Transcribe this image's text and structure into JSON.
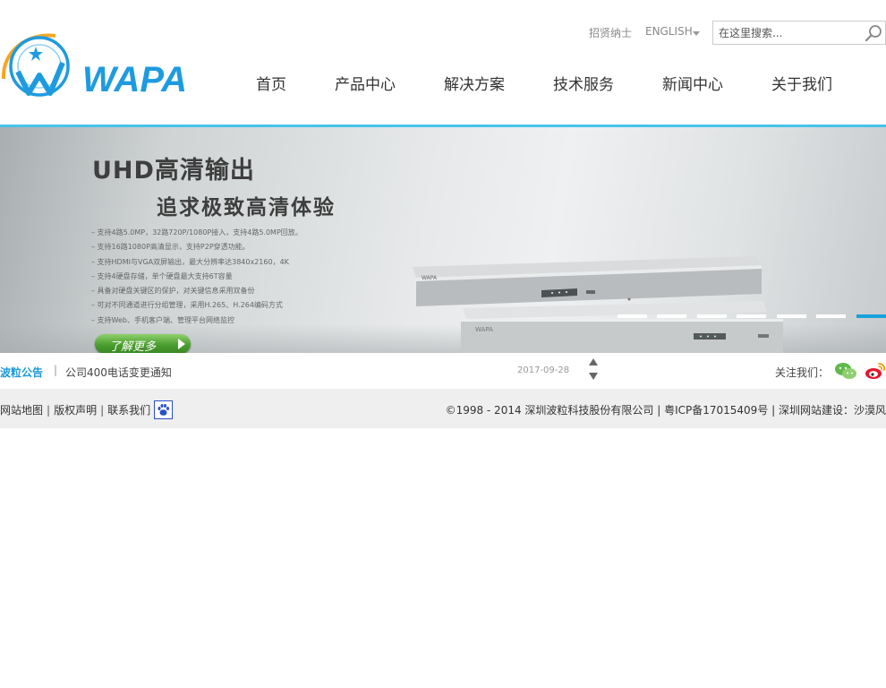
{
  "header": {
    "logo_text": "WAPA",
    "recruit_label": "招贤纳士",
    "language_label": "ENGLISH",
    "search_placeholder": "在这里搜索..."
  },
  "nav": {
    "items": [
      {
        "label": "首页"
      },
      {
        "label": "产品中心"
      },
      {
        "label": "解决方案"
      },
      {
        "label": "技术服务"
      },
      {
        "label": "新闻中心"
      },
      {
        "label": "关于我们"
      }
    ]
  },
  "banner": {
    "title_line1": "UHD高清输出",
    "title_line2": "追求极致高清体验",
    "features": [
      "– 支持4路5.0MP，32路720P/1080P接入，支持4路5.0MP回放。",
      "– 支持16路1080P高清显示，支持P2P穿透功能。",
      "– 支持HDMI与VGA双屏输出，最大分辨率达3840x2160，4K",
      "– 支持4硬盘存储，单个硬盘最大支持6T容量",
      "– 具备对硬盘关键区的保护，对关键信息采用双备份",
      "– 可对不同通道进行分组管理，采用H.265、H.264编码方式",
      "– 支持Web、手机客户端、管理平台网络监控"
    ],
    "more_button": "了解更多",
    "slide_count": 7,
    "active_slide": 7
  },
  "notice": {
    "label": "波粒公告",
    "separator": "|",
    "text": "公司400电话变更通知",
    "date": "2017-09-28",
    "follow_label": "关注我们："
  },
  "footer": {
    "links": [
      "网站地图",
      "版权声明",
      "联系我们"
    ],
    "copyright": "©1998 - 2014 深圳波粒科技股份有限公司 | 粤ICP备17015409号 | 深圳网站建设：沙漠风"
  },
  "colors": {
    "accent_cyan": "#46c3ea",
    "notice_blue": "#1c9ad6",
    "button_green": "#4a9d2e",
    "active_dot": "#1aa1dc"
  }
}
